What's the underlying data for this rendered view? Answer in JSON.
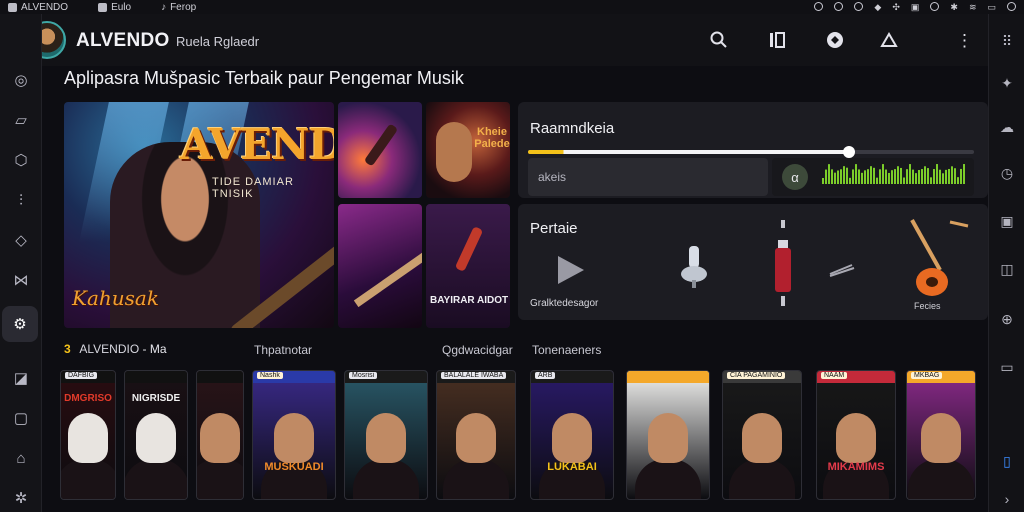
{
  "status_bar": {
    "items": [
      {
        "label": "ALVENDO",
        "icon": "app-icon"
      },
      {
        "label": "Eulo",
        "icon": "file-icon"
      },
      {
        "label": "Ferop",
        "icon": "music-note-icon"
      }
    ]
  },
  "header": {
    "title": "ALVENDO",
    "subtitle": "Ruela Rglaedr"
  },
  "page": {
    "title": "Aplipasra Mušpasic Terbaik paur Pengemar Musik"
  },
  "hero": {
    "brand": "AVENDO",
    "tagline": "TIDE DAMIAR TNISIK",
    "signature": "Kahusak",
    "tile_b_label": "Kheie Palede",
    "tile_d_label": "BAYIRAR AIDOT"
  },
  "player": {
    "title": "Raamndkeia",
    "progress": 0.72,
    "input_placeholder": "akeis",
    "eq_button_icon": "alpha-icon",
    "accent": "#f4c21a",
    "eq_color": "#7ccd2a"
  },
  "tools": {
    "title": "Pertaie",
    "caption": "Gralktedesagor",
    "caption_right": "Fecies"
  },
  "section": {
    "number": "3",
    "brand": "ALVENDIO",
    "brand_accent": "O",
    "suffix": "Ma",
    "link_1": "Thpatnotar",
    "link_2": "Qgdwacidgar",
    "link_3": "Tonenaeners"
  },
  "cards": [
    {
      "bar": "DAFBIG",
      "cap": "DMGRISO",
      "bar_color": "#111111",
      "cap_color": "#e23a2a",
      "bg": "#2a0c10"
    },
    {
      "bar": "",
      "cap": "NIGRISDE",
      "bar_color": "#111111",
      "cap_color": "#f0f0f0",
      "bg": "#1a1014"
    },
    {
      "bar": "",
      "cap": "",
      "bar_color": "#111111",
      "cap_color": "#f0f0f0",
      "bg": "#2a1418"
    },
    {
      "bar": "Nashk",
      "cap": "MUSKUADI",
      "bar_color": "#2a3aa8",
      "cap_color": "#f08a2a",
      "bg": "#3a2a8a"
    },
    {
      "bar": "Mosrisi",
      "cap": "",
      "bar_color": "#1a1a1a",
      "cap_color": "#f4c21a",
      "bg": "#2a5a6a"
    },
    {
      "bar": "BALALALE IWABA",
      "cap": "",
      "bar_color": "#1a1a1a",
      "cap_color": "#f0f0f0",
      "bg": "#4a3022"
    },
    {
      "bar": "ARB",
      "cap": "LUKABAI",
      "bar_color": "#1a1a1a",
      "cap_color": "#f4c21a",
      "bg": "#2a1a6a"
    },
    {
      "bar": "",
      "cap": "",
      "bar_color": "#f4a82a",
      "cap_color": "#f0f0f0",
      "bg": "#f2f2f0"
    },
    {
      "bar": "CIA PAGAMINIO",
      "cap": "",
      "bar_color": "#3a3a3a",
      "cap_color": "#f0f0f0",
      "bg": "#1a1a1a"
    },
    {
      "bar": "NAAM",
      "cap": "MIKAMIMS",
      "bar_color": "#c42a3a",
      "cap_color": "#e23a4a",
      "bg": "#181818"
    },
    {
      "bar": "MKBAG",
      "cap": "",
      "bar_color": "#f4a82a",
      "cap_color": "#f0f0f0",
      "bg": "#8a2a8a"
    }
  ]
}
